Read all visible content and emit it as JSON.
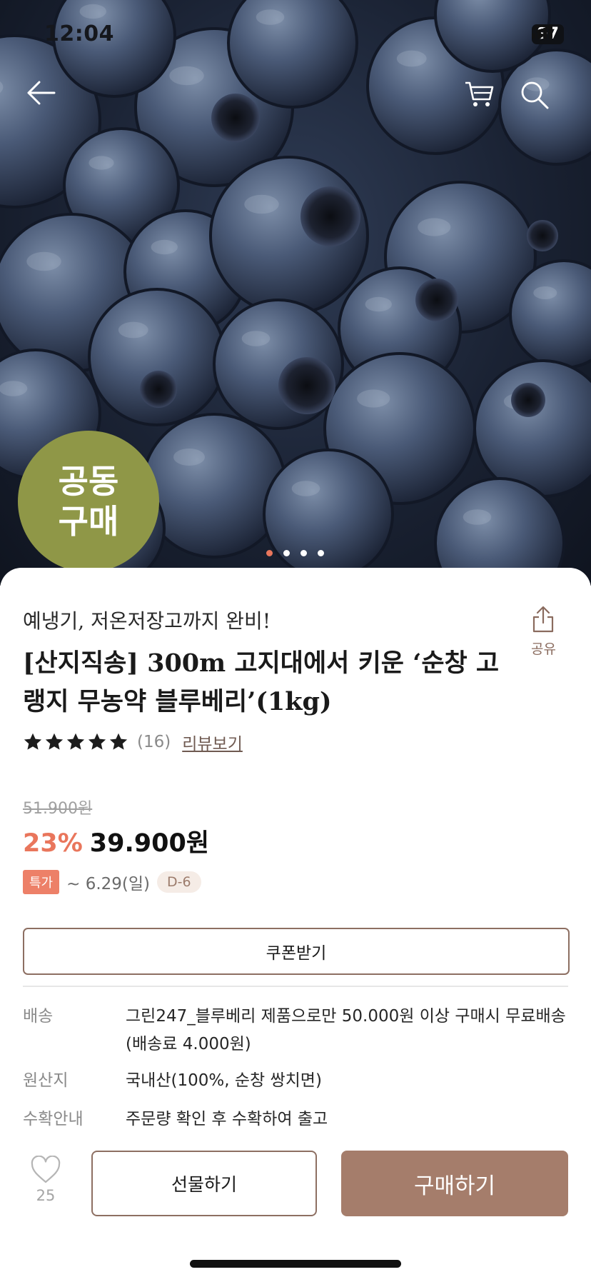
{
  "status_bar": {
    "time": "12:04",
    "battery": "97"
  },
  "nav": {
    "back_icon": "arrow-left-icon",
    "cart_icon": "cart-icon",
    "search_icon": "search-icon"
  },
  "hero": {
    "badge_line1": "공동",
    "badge_line2": "구매",
    "slides_total": 4,
    "active_slide": 1
  },
  "product": {
    "subtitle": "예냉기, 저온저장고까지 완비!",
    "title": "[산지직송] 300m 고지대에서 키운 ‘순창 고랭지 무농약 블루베리’(1kg)",
    "share_label": "공유",
    "rating_stars": 5,
    "review_count": "(16)",
    "review_link": "리뷰보기",
    "original_price": "51.900원",
    "discount": "23%",
    "price": "39.900원",
    "promo_tag": "특가",
    "promo_period": "~ 6.29(일)",
    "promo_dday": "D-6",
    "coupon_label": "쿠폰받기"
  },
  "info": [
    {
      "label": "배송",
      "value": "그린247_블루베리 제품으로만 50.000원 이상 구매시 무료배송 (배송료 4.000원)"
    },
    {
      "label": "원산지",
      "value": "국내산(100%, 순창 쌍치면)"
    },
    {
      "label": "수확안내",
      "value": "주문량 확인 후 수확하여 출고"
    }
  ],
  "actions": {
    "like_count": "25",
    "gift_label": "선물하기",
    "buy_label": "구매하기"
  },
  "colors": {
    "accent_brown": "#a57d6b",
    "discount_red": "#e9765c",
    "badge_olive": "#8f9747"
  }
}
